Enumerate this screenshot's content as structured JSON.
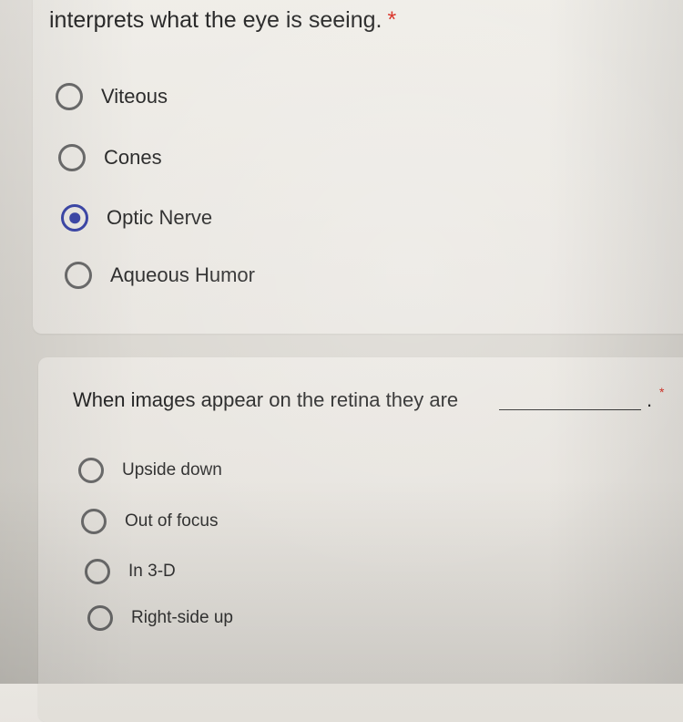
{
  "question_1": {
    "title": "interprets what the eye is seeing.",
    "required_mark": "*",
    "options": [
      {
        "label": "Viteous",
        "selected": false
      },
      {
        "label": "Cones",
        "selected": false
      },
      {
        "label": "Optic Nerve",
        "selected": true
      },
      {
        "label": "Aqueous Humor",
        "selected": false
      }
    ]
  },
  "question_2": {
    "title": "When images appear on the retina they are",
    "trailing_punct": ".",
    "required_mark": "*",
    "options": [
      {
        "label": "Upside down",
        "selected": false
      },
      {
        "label": "Out of focus",
        "selected": false
      },
      {
        "label": "In 3-D",
        "selected": false
      },
      {
        "label": "Right-side up",
        "selected": false
      }
    ]
  },
  "colors": {
    "accent": "#3d48a8",
    "required": "#d93025",
    "radio_border": "#6b6b6b"
  }
}
